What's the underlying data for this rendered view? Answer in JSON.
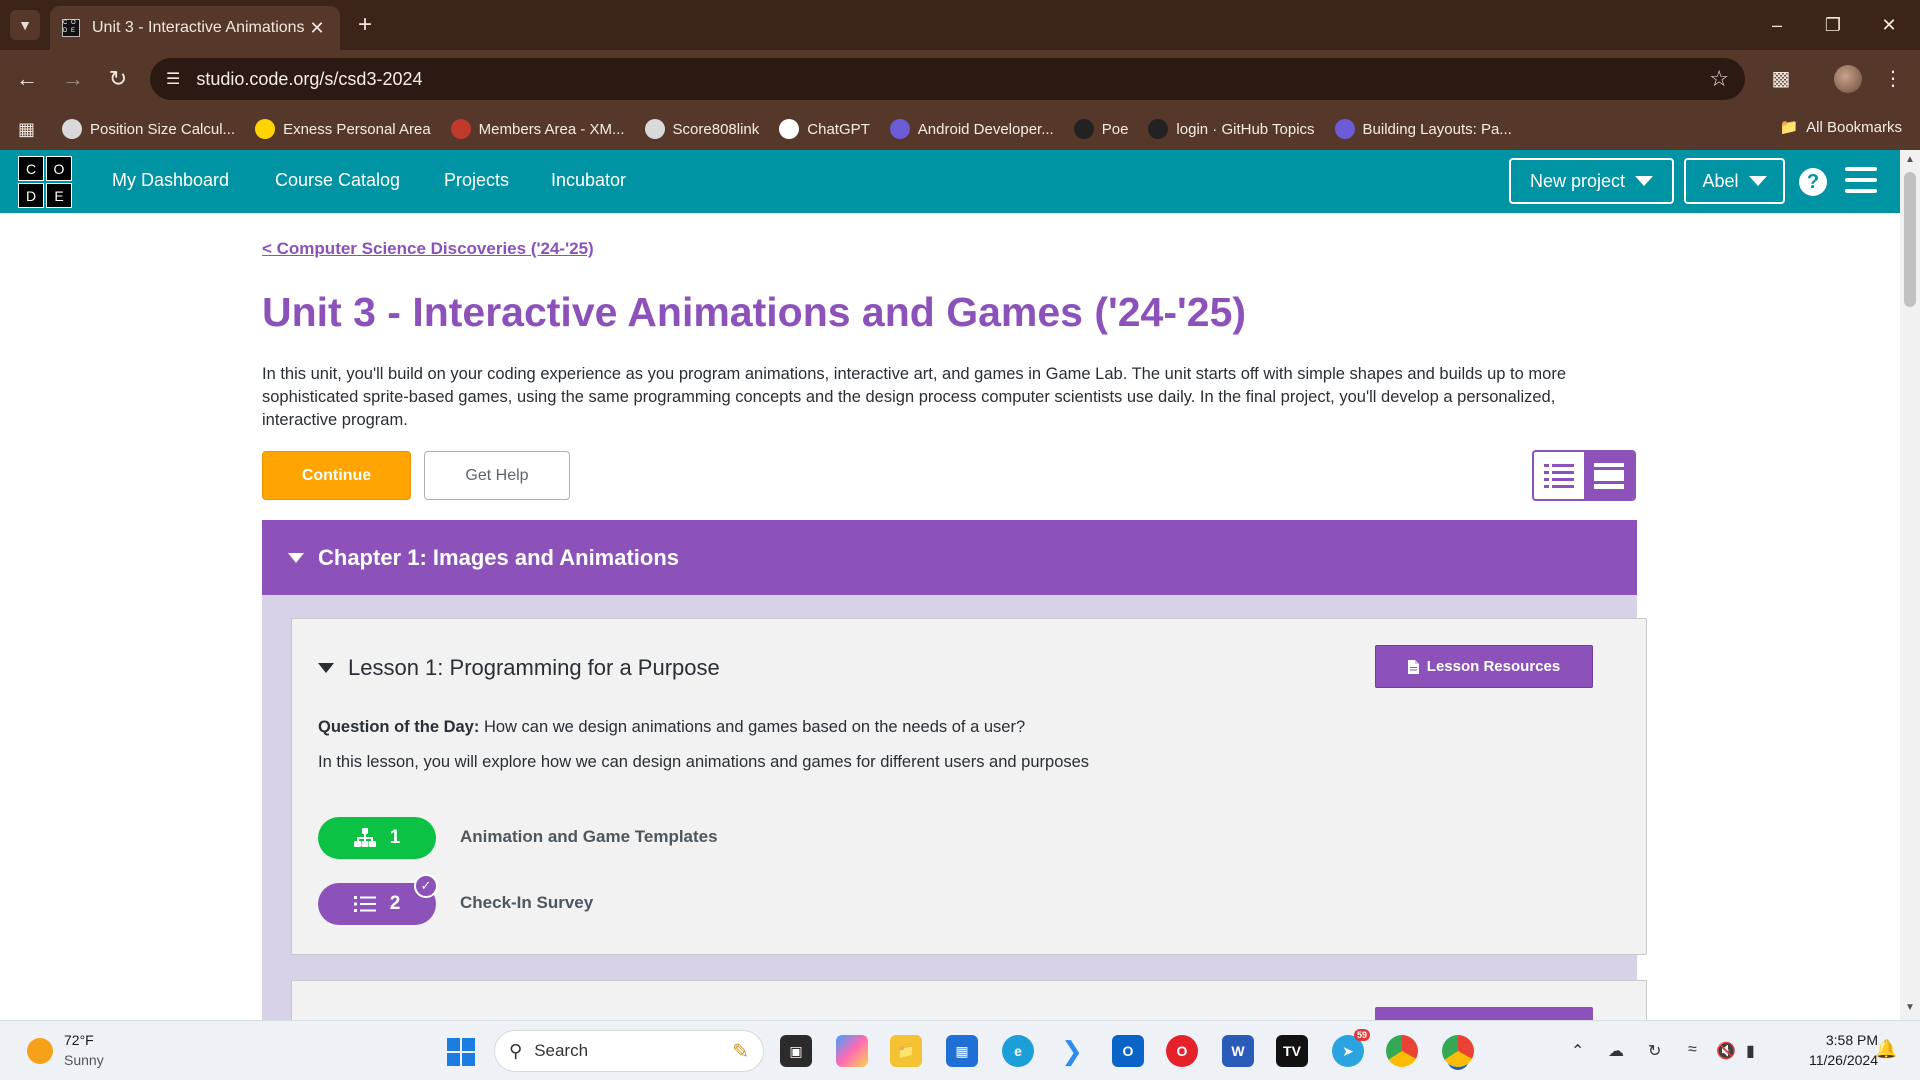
{
  "browser": {
    "tab_title": "Unit 3 - Interactive Animations",
    "url": "studio.code.org/s/csd3-2024",
    "bookmarks": [
      {
        "label": "Position Size Calcul...",
        "icon_color": "#d9d9d9"
      },
      {
        "label": "Exness Personal Area",
        "icon_color": "#ffd400"
      },
      {
        "label": "Members Area - XM...",
        "icon_color": "#c0392b"
      },
      {
        "label": "Score808link",
        "icon_color": "#d9d9d9"
      },
      {
        "label": "ChatGPT",
        "icon_color": "#ffffff"
      },
      {
        "label": "Android Developer...",
        "icon_color": "#6b5bd6"
      },
      {
        "label": "Poe",
        "icon_color": "#222222"
      },
      {
        "label": "login · GitHub Topics",
        "icon_color": "#222222"
      },
      {
        "label": "Building Layouts: Pa...",
        "icon_color": "#6b5bd6"
      }
    ],
    "all_bookmarks": "All Bookmarks"
  },
  "header": {
    "logo_letters": [
      "C",
      "O",
      "D",
      "E"
    ],
    "nav": [
      "My Dashboard",
      "Course Catalog",
      "Projects",
      "Incubator"
    ],
    "new_project": "New project",
    "user": "Abel",
    "help": "?"
  },
  "unit": {
    "back_link": "< Computer Science Discoveries ('24-'25)",
    "title": "Unit 3 - Interactive Animations and Games ('24-'25)",
    "description": "In this unit, you'll build on your coding experience as you program animations, interactive art, and games in Game Lab. The unit starts off with simple shapes and builds up to more sophisticated sprite-based games, using the same programming concepts and the design process computer scientists use daily. In the final project, you'll develop a personalized, interactive program.",
    "continue_label": "Continue",
    "get_help_label": "Get Help"
  },
  "chapter": {
    "title": "Chapter 1: Images and Animations",
    "lesson": {
      "title": "Lesson 1: Programming for a Purpose",
      "resources_label": "Lesson Resources",
      "qotd_label": "Question of the Day:",
      "qotd_text": "How can we design animations and games based on the needs of a user?",
      "description": "In this lesson, you will explore how we can design animations and games for different users and purposes",
      "levels": [
        {
          "number": "1",
          "label": "Animation and Game Templates",
          "icon": "sitemap-icon",
          "color": "#0cc245",
          "completed": false
        },
        {
          "number": "2",
          "label": "Check-In Survey",
          "icon": "list-icon",
          "color": "#8c52ba",
          "completed": true
        }
      ]
    }
  },
  "taskbar": {
    "temperature": "72°F",
    "condition": "Sunny",
    "search_placeholder": "Search",
    "telegram_badge": "59",
    "time": "3:58 PM",
    "date": "11/26/2024"
  }
}
